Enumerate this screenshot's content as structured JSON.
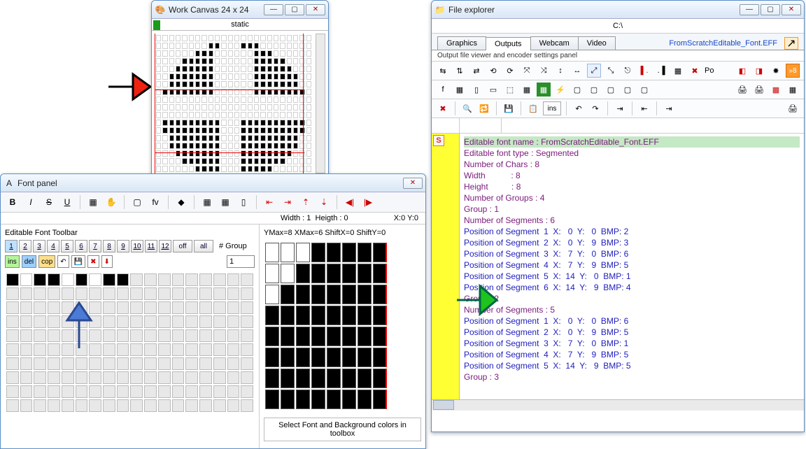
{
  "workcanvas": {
    "title": "Work Canvas 24 x 24",
    "mode": "static"
  },
  "fontpanel": {
    "title": "Font panel",
    "width_label": "Width : 1",
    "height_label": "Heigth : 0",
    "coord": "X:0 Y:0",
    "ymax": "YMax=8 XMax=6 ShiftX=0 ShiftY=0",
    "toolbar_title": "Editable Font Toolbar",
    "numbers": [
      "1",
      "2",
      "3",
      "4",
      "5",
      "6",
      "7",
      "8",
      "9",
      "10",
      "11",
      "12"
    ],
    "off": "off",
    "all": "all",
    "group_label": "# Group",
    "ins": "ins",
    "del": "del",
    "cop": "cop",
    "spinner_value": "1",
    "hint": "Select Font and Background colors in toolbox",
    "biust": {
      "b": "B",
      "i": "I",
      "s": "S",
      "u": "U",
      "fv": "fv",
      "po": "Po"
    }
  },
  "fileexp": {
    "title": "File explorer",
    "path": "C:\\",
    "tabs": [
      "Graphics",
      "Outputs",
      "Webcam",
      "Video"
    ],
    "active_tab": "Outputs",
    "link": "FromScratchEditable_Font.EFF",
    "panel_label": "Output file viewer and encoder settings panel",
    "ins_btn": "ins",
    "po_label": "Po",
    "lines": [
      {
        "hl": true,
        "t": "Editable font name : FromScratchEditable_Font.EFF"
      },
      {
        "t": "Editable font type : Segmented"
      },
      {
        "t": "Number of Chars : 8"
      },
      {
        "t": "Width           : 8"
      },
      {
        "t": "Height          : 8"
      },
      {
        "t": "Number of Groups : 4"
      },
      {
        "t": "Group : 1"
      },
      {
        "t": "Number of Segments : 6"
      },
      {
        "blue": true,
        "t": "Position of Segment  1  X:   0  Y:   0  BMP: 2"
      },
      {
        "blue": true,
        "t": "Position of Segment  2  X:   0  Y:   9  BMP: 3"
      },
      {
        "blue": true,
        "t": "Position of Segment  3  X:   7  Y:   0  BMP: 6"
      },
      {
        "blue": true,
        "t": "Position of Segment  4  X:   7  Y:   9  BMP: 5"
      },
      {
        "blue": true,
        "t": "Position of Segment  5  X:  14  Y:   0  BMP: 1"
      },
      {
        "blue": true,
        "t": "Position of Segment  6  X:  14  Y:   9  BMP: 4"
      },
      {
        "t": "Group : 2"
      },
      {
        "t": "Number of Segments : 5"
      },
      {
        "blue": true,
        "t": "Position of Segment  1  X:   0  Y:   0  BMP: 6"
      },
      {
        "blue": true,
        "t": "Position of Segment  2  X:   0  Y:   9  BMP: 5"
      },
      {
        "blue": true,
        "t": "Position of Segment  3  X:   7  Y:   0  BMP: 1"
      },
      {
        "blue": true,
        "t": "Position of Segment  4  X:   7  Y:   9  BMP: 5"
      },
      {
        "blue": true,
        "t": "Position of Segment  5  X:  14  Y:   9  BMP: 5"
      },
      {
        "t": "Group : 3"
      }
    ]
  }
}
